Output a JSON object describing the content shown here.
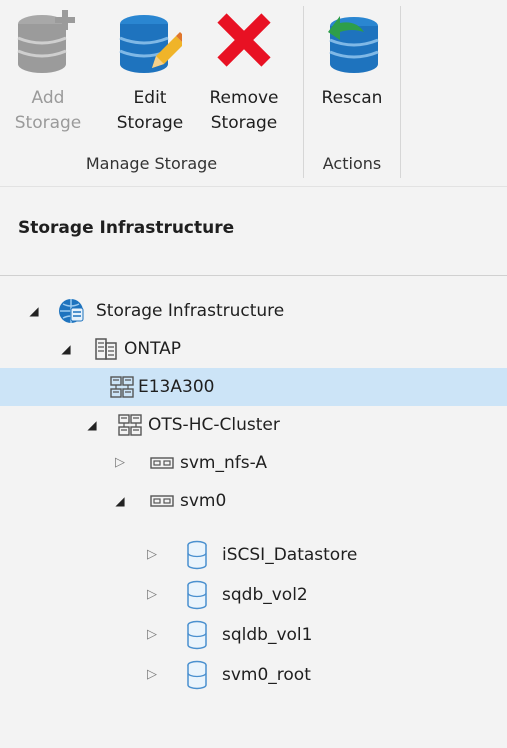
{
  "ribbon": {
    "manage_group_label": "Manage Storage",
    "actions_group_label": "Actions",
    "add": {
      "line1": "Add",
      "line2": "Storage",
      "icon": "database-add-icon"
    },
    "edit": {
      "line1": "Edit",
      "line2": "Storage",
      "icon": "database-edit-icon"
    },
    "remove": {
      "line1": "Remove",
      "line2": "Storage",
      "icon": "remove-x-icon"
    },
    "rescan": {
      "line1": "Rescan",
      "line2": "",
      "icon": "database-rescan-icon"
    }
  },
  "panel": {
    "title": "Storage Infrastructure"
  },
  "tree": {
    "root": "Storage Infrastructure",
    "ontap": "ONTAP",
    "e13a300": "E13A300",
    "cluster": "OTS-HC-Cluster",
    "svm_nfs": "svm_nfs-A",
    "svm0": "svm0",
    "vol_iscsi": "iSCSI_Datastore",
    "vol_sqdb": "sqdb_vol2",
    "vol_sqldb": "sqldb_vol1",
    "vol_root": "svm0_root"
  },
  "colors": {
    "selected_row": "#cce4f7",
    "db_blue": "#1e73be",
    "remove_red": "#e81123",
    "rescan_green": "#2e9e4a"
  }
}
